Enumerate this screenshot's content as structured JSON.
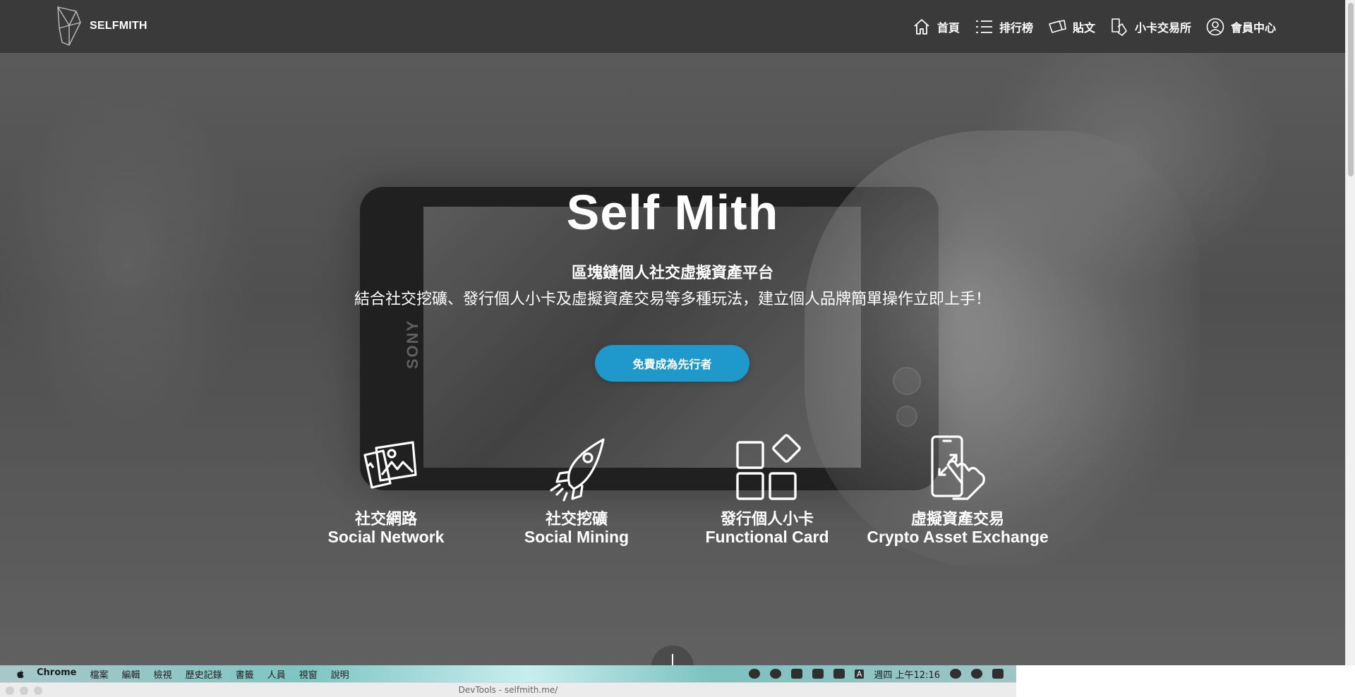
{
  "brand": {
    "name": "SELFMITH"
  },
  "nav": {
    "items": [
      {
        "label": "首頁",
        "icon": "home-icon"
      },
      {
        "label": "排行榜",
        "icon": "ranking-list-icon"
      },
      {
        "label": "貼文",
        "icon": "posts-icon"
      },
      {
        "label": "小卡交易所",
        "icon": "card-exchange-icon"
      },
      {
        "label": "會員中心",
        "icon": "user-icon"
      }
    ]
  },
  "hero": {
    "title": "Self Mith",
    "subtitle": "區塊鏈個人社交虛擬資產平台",
    "tagline": "結合社交挖礦、發行個人小卡及虛擬資產交易等多種玩法，建立個人品牌簡單操作立即上手！",
    "cta": "免費成為先行者",
    "phone_brand": "SONY"
  },
  "features": [
    {
      "zh": "社交網路",
      "en": "Social Network",
      "icon": "photos-icon"
    },
    {
      "zh": "社交挖礦",
      "en": "Social Mining",
      "icon": "rocket-icon"
    },
    {
      "zh": "發行個人小卡",
      "en": "Functional Card",
      "icon": "apps-grid-icon"
    },
    {
      "zh": "虛擬資產交易",
      "en": "Crypto Asset Exchange",
      "icon": "touch-phone-icon"
    }
  ],
  "os": {
    "menu": [
      "Chrome",
      "檔案",
      "編輯",
      "檢視",
      "歷史記錄",
      "書籤",
      "人員",
      "視窗",
      "說明"
    ],
    "clock": "週四 上午12:16",
    "input_indicator": "A"
  },
  "devtools": {
    "title": "DevTools - selfmith.me/"
  },
  "colors": {
    "header": "#3a3a3a",
    "accent": "#1f98cc"
  }
}
